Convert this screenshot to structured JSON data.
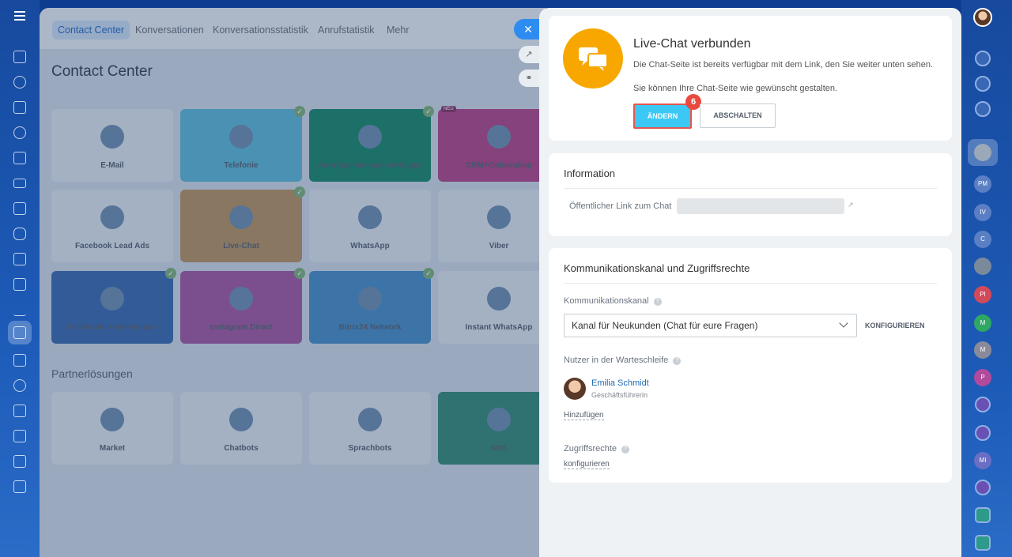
{
  "nav_tabs": [
    "Contact Center",
    "Konversationen",
    "Konversationsstatistik",
    "Anrufstatistik",
    "Mehr"
  ],
  "page_title": "Contact Center",
  "tiles": [
    {
      "label": "E-Mail",
      "checked": false,
      "color": "#dbe3ec"
    },
    {
      "label": "Telefonie",
      "checked": true,
      "color": "#5fb8d6"
    },
    {
      "label": "Anrufquellen nachverfolgen",
      "checked": true,
      "color": "#1f8a6e"
    },
    {
      "label": "CRM+Onlineshop",
      "checked": false,
      "color": "#b04a8a",
      "badge": "NEU"
    },
    {
      "label": "Facebook Lead Ads",
      "checked": false,
      "color": "#dbe3ec"
    },
    {
      "label": "Live-Chat",
      "checked": true,
      "color": "#b89466"
    },
    {
      "label": "WhatsApp",
      "checked": false,
      "color": "#dbe3ec"
    },
    {
      "label": "Viber",
      "checked": false,
      "color": "#dbe3ec"
    },
    {
      "label": "Facebook: Kommentare",
      "checked": true,
      "color": "#3e6db1"
    },
    {
      "label": "Instagram Direct",
      "checked": true,
      "color": "#a25ca3"
    },
    {
      "label": "Bitrix24 Network",
      "checked": true,
      "color": "#4b8fc7"
    },
    {
      "label": "Instant WhatsApp",
      "checked": false,
      "color": "#dbe3ec"
    }
  ],
  "partner_heading": "Partnerlösungen",
  "partners": [
    "Market",
    "Chatbots",
    "Sprachbots",
    "SMS"
  ],
  "panel": {
    "title": "Live-Chat verbunden",
    "desc1": "Die Chat-Seite ist bereits verfügbar mit dem Link, den Sie weiter unten sehen.",
    "desc2": "Sie können Ihre Chat-Seite wie gewünscht gestalten.",
    "change_button": "ÄNDERN",
    "off_button": "ABSCHALTEN",
    "step_badge": "6",
    "info_title": "Information",
    "public_link_label": "Öffentlicher Link zum Chat",
    "comm_title": "Kommunikationskanal und Zugriffsrechte",
    "channel_label": "Kommunikationskanal",
    "channel_value": "Kanal für Neukunden (Chat für eure Fragen)",
    "configure_button": "KONFIGURIEREN",
    "queue_label": "Nutzer in der Warteschleife",
    "user_name": "Emilia Schmidt",
    "user_role": "Geschäftsführerin",
    "add_link": "Hinzufügen",
    "rights_label": "Zugriffsrechte",
    "rights_link": "konfigurieren"
  },
  "right_avatars": [
    "PM",
    "IV",
    "C",
    "PI",
    "M",
    "M",
    "P",
    "MI"
  ],
  "colors": {
    "accent": "#3bc8f5",
    "highlight": "#e4554f",
    "livechat_icon": "#f7a700"
  }
}
